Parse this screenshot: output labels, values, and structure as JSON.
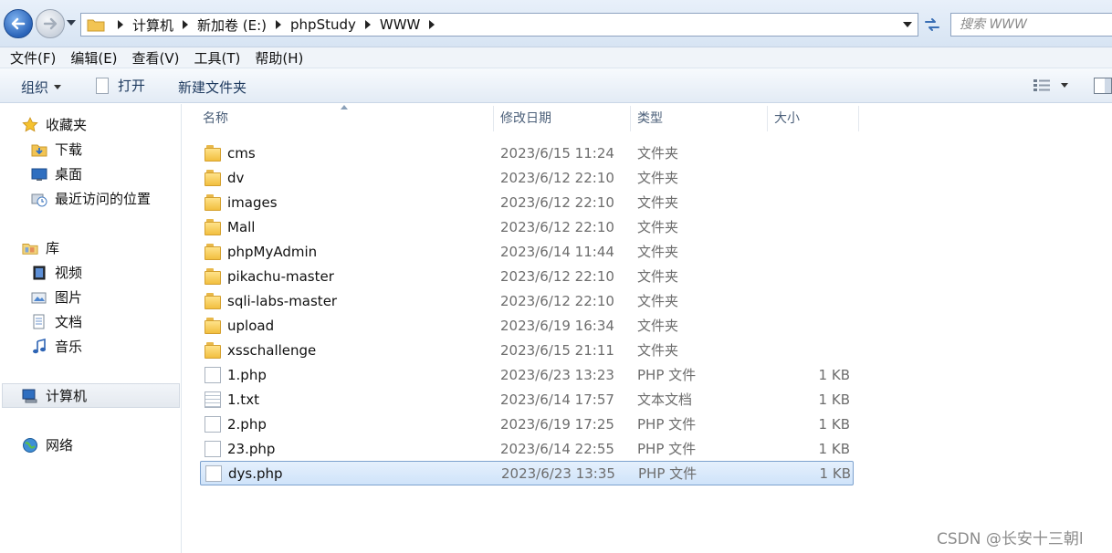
{
  "address": {
    "breadcrumbs": [
      "计算机",
      "新加卷 (E:)",
      "phpStudy",
      "WWW"
    ],
    "search_placeholder": "搜索 WWW"
  },
  "menu": [
    "文件(F)",
    "编辑(E)",
    "查看(V)",
    "工具(T)",
    "帮助(H)"
  ],
  "toolbar": {
    "organize": "组织",
    "open": "打开",
    "new_folder": "新建文件夹"
  },
  "nav": {
    "favorites": "收藏夹",
    "downloads": "下载",
    "desktop": "桌面",
    "recent": "最近访问的位置",
    "libraries": "库",
    "videos": "视频",
    "pictures": "图片",
    "documents": "文档",
    "music": "音乐",
    "computer": "计算机",
    "network": "网络"
  },
  "columns": [
    "名称",
    "修改日期",
    "类型",
    "大小"
  ],
  "files": [
    {
      "name": "cms",
      "date": "2023/6/15 11:24",
      "type": "文件夹",
      "size": "",
      "icon": "folder-icon"
    },
    {
      "name": "dv",
      "date": "2023/6/12 22:10",
      "type": "文件夹",
      "size": "",
      "icon": "folder-icon"
    },
    {
      "name": "images",
      "date": "2023/6/12 22:10",
      "type": "文件夹",
      "size": "",
      "icon": "folder-icon"
    },
    {
      "name": "Mall",
      "date": "2023/6/12 22:10",
      "type": "文件夹",
      "size": "",
      "icon": "folder-icon"
    },
    {
      "name": "phpMyAdmin",
      "date": "2023/6/14 11:44",
      "type": "文件夹",
      "size": "",
      "icon": "folder-icon"
    },
    {
      "name": "pikachu-master",
      "date": "2023/6/12 22:10",
      "type": "文件夹",
      "size": "",
      "icon": "folder-icon"
    },
    {
      "name": "sqli-labs-master",
      "date": "2023/6/12 22:10",
      "type": "文件夹",
      "size": "",
      "icon": "folder-icon"
    },
    {
      "name": "upload",
      "date": "2023/6/19 16:34",
      "type": "文件夹",
      "size": "",
      "icon": "folder-icon"
    },
    {
      "name": "xsschallenge",
      "date": "2023/6/15 21:11",
      "type": "文件夹",
      "size": "",
      "icon": "folder-icon"
    },
    {
      "name": "1.php",
      "date": "2023/6/23 13:23",
      "type": "PHP 文件",
      "size": "1 KB",
      "icon": "php-file-icon"
    },
    {
      "name": "1.txt",
      "date": "2023/6/14 17:57",
      "type": "文本文档",
      "size": "1 KB",
      "icon": "text-file-icon"
    },
    {
      "name": "2.php",
      "date": "2023/6/19 17:25",
      "type": "PHP 文件",
      "size": "1 KB",
      "icon": "php-file-icon"
    },
    {
      "name": "23.php",
      "date": "2023/6/14 22:55",
      "type": "PHP 文件",
      "size": "1 KB",
      "icon": "php-file-icon"
    },
    {
      "name": "dys.php",
      "date": "2023/6/23 13:35",
      "type": "PHP 文件",
      "size": "1 KB",
      "icon": "php-file-icon",
      "selected": true
    }
  ],
  "watermark": "CSDN @长安十三朝l"
}
